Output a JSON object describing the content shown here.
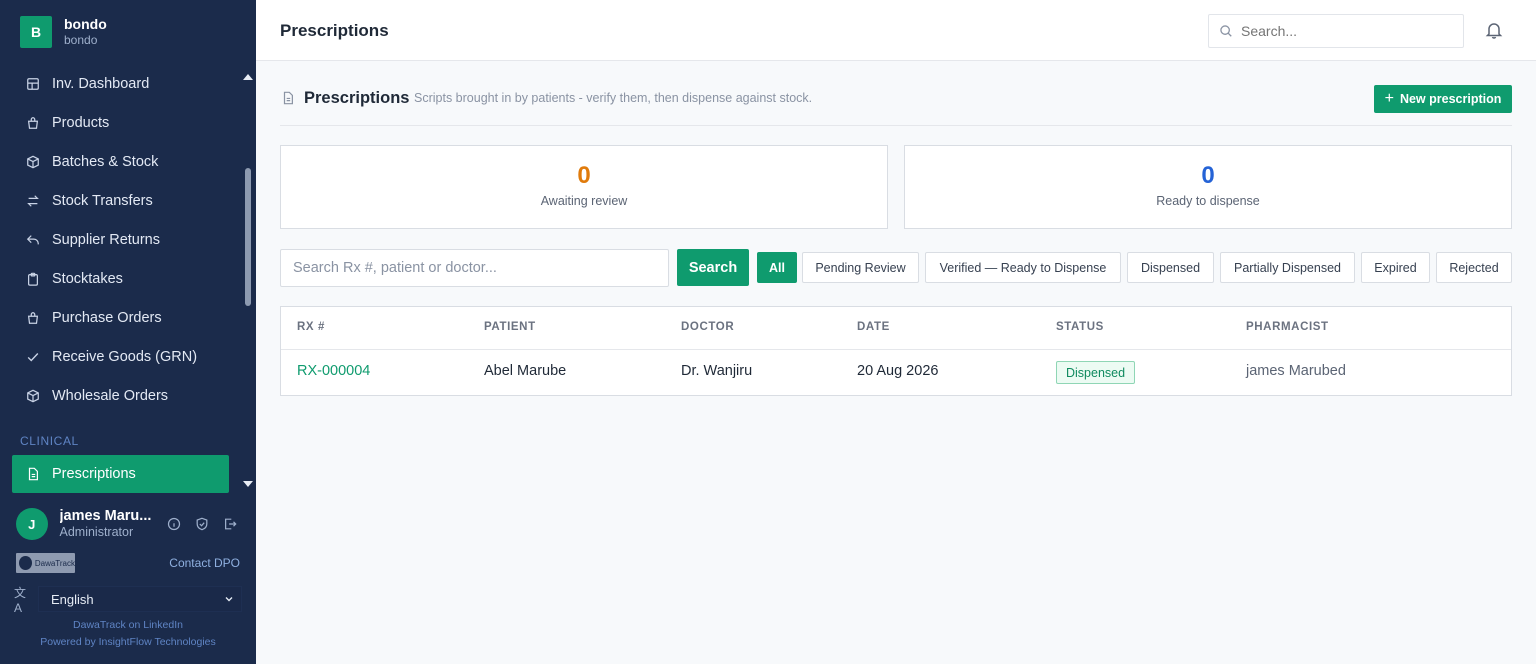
{
  "brand": {
    "initial": "B",
    "name": "bondo",
    "subtitle": "bondo"
  },
  "nav": {
    "items": [
      {
        "label": "Inv. Dashboard",
        "icon": "dashboard-icon"
      },
      {
        "label": "Products",
        "icon": "bag-icon"
      },
      {
        "label": "Batches & Stock",
        "icon": "box-icon"
      },
      {
        "label": "Stock Transfers",
        "icon": "transfer-icon"
      },
      {
        "label": "Supplier Returns",
        "icon": "return-icon"
      },
      {
        "label": "Stocktakes",
        "icon": "clipboard-icon"
      },
      {
        "label": "Purchase Orders",
        "icon": "bag-icon"
      },
      {
        "label": "Receive Goods (GRN)",
        "icon": "check-icon"
      },
      {
        "label": "Wholesale Orders",
        "icon": "box-icon"
      }
    ],
    "section_label": "CLINICAL",
    "active_item": {
      "label": "Prescriptions",
      "icon": "document-icon"
    }
  },
  "user": {
    "initial": "J",
    "name": "james Maru...",
    "role": "Administrator"
  },
  "sidebar_footer": {
    "logo_text": "DawaTrack",
    "contact": "Contact DPO",
    "language": "English",
    "linkedin": "DawaTrack on LinkedIn",
    "powered_by": "Powered by InsightFlow Technologies"
  },
  "topbar": {
    "title": "Prescriptions",
    "search_placeholder": "Search..."
  },
  "page": {
    "title": "Prescriptions",
    "subtitle": "Scripts brought in by patients - verify them, then dispense against stock.",
    "new_button": "New prescription"
  },
  "stats": [
    {
      "value": "0",
      "label": "Awaiting review",
      "color": "#e07b0c"
    },
    {
      "value": "0",
      "label": "Ready to dispense",
      "color": "#2563d6"
    }
  ],
  "filters": {
    "search_placeholder": "Search Rx #, patient or doctor...",
    "search_button": "Search",
    "chips": [
      "All",
      "Pending Review",
      "Verified — Ready to Dispense",
      "Dispensed",
      "Partially Dispensed",
      "Expired",
      "Rejected"
    ],
    "active_chip": "All"
  },
  "table": {
    "columns": [
      "RX #",
      "PATIENT",
      "DOCTOR",
      "DATE",
      "STATUS",
      "PHARMACIST"
    ],
    "rows": [
      {
        "rx": "RX-000004",
        "patient": "Abel Marube",
        "doctor": "Dr. Wanjiru",
        "date": "20 Aug 2026",
        "status": "Dispensed",
        "pharmacist": "james Marubed"
      }
    ]
  },
  "colors": {
    "sidebar_bg": "#1b2b4b",
    "accent": "#0f9b6e",
    "awaiting": "#e07b0c",
    "ready": "#2563d6"
  }
}
